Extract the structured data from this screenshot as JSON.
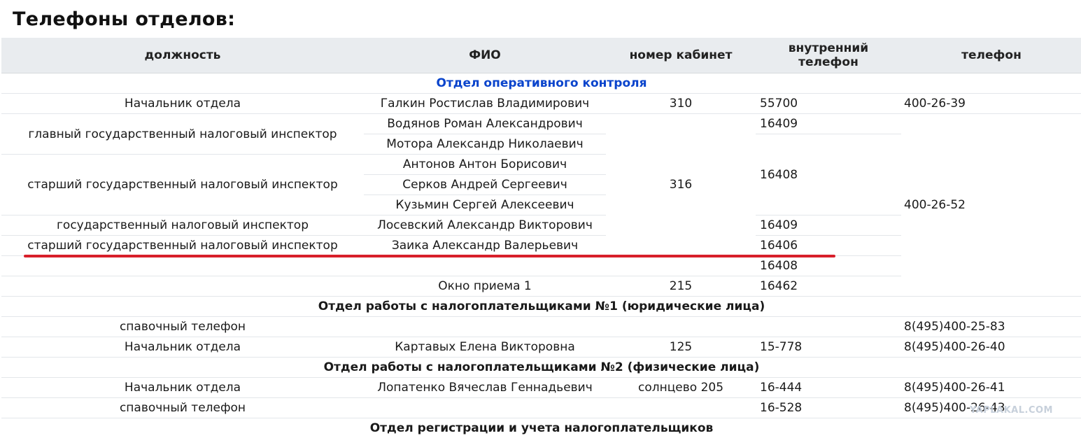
{
  "title": "Телефоны отделов:",
  "headers": {
    "position": "должность",
    "name": "ФИО",
    "room": "номер кабинет",
    "internal": "внутренний телефон",
    "phone": "телефон"
  },
  "sections": {
    "ops": "Отдел оперативного контроля",
    "tp1": "Отдел работы с налогоплательщиками №1 (юридические лица)",
    "tp2": "Отдел работы с налогоплательщиками №2 (физические лица)",
    "reg": "Отдел регистрации и учета налогоплательщиков"
  },
  "ops": {
    "head_position": "Начальник отдела",
    "head_name": "Галкин Ростислав Владимирович",
    "head_room": "310",
    "head_internal": "55700",
    "head_phone": "400-26-39",
    "pos_chief_inspector": "главный государственный налоговый инспектор",
    "pos_senior_inspector": "старший государственный налоговый инспектор",
    "pos_inspector": "государственный налоговый инспектор",
    "pos_senior_inspector_2": "старший государственный налоговый инспектор",
    "name_1": "Водянов Роман Александрович",
    "name_2": "Мотора Александр Николаевич",
    "name_3": "Антонов Антон Борисович",
    "name_4": "Серков Андрей Сергеевич",
    "name_5": "Кузьмин Сергей Алексеевич",
    "name_6": "Лосевский Александр Викторович",
    "name_7": "Заика Александр Валерьевич",
    "room_group": "316",
    "int_1": "16409",
    "int_2": "16408",
    "int_3": "16409",
    "int_4": "16406",
    "int_5": "16408",
    "group_phone": "400-26-52",
    "window_name": "Окно приема 1",
    "window_room": "215",
    "window_internal": "16462"
  },
  "tp1": {
    "ref_position": "спавочный телефон",
    "ref_phone": "8(495)400-25-83",
    "head_position": "Начальник отдела",
    "head_name": "Картавых Елена Викторовна",
    "head_room": "125",
    "head_internal": "15-778",
    "head_phone": "8(495)400-26-40"
  },
  "tp2": {
    "head_position": "Начальник отдела",
    "head_name": "Лопатенко Вячеслав Геннадьевич",
    "head_room": "солнцево 205",
    "head_internal": "16-444",
    "head_phone": "8(495)400-26-41",
    "ref_position": "спавочный телефон",
    "ref_internal": "16-528",
    "ref_phone": "8(495)400-26-43"
  },
  "watermark": "YAPLAKAL.COM",
  "colors": {
    "header_bg": "#e9ecef",
    "section_blue": "#0a44cc",
    "highlight_red": "#d81f2a"
  }
}
